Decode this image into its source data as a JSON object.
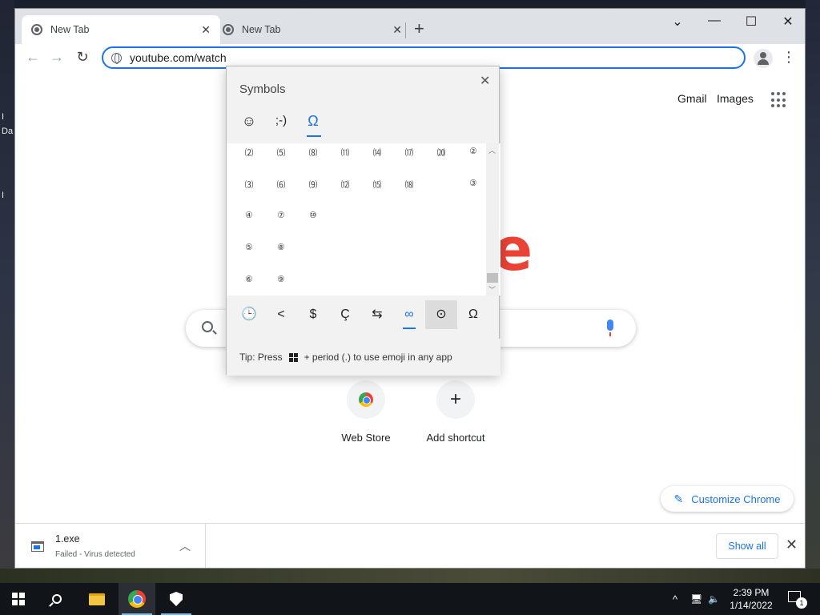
{
  "desktop": {
    "left_texts": [
      "I",
      "Da",
      "I"
    ]
  },
  "browser": {
    "tabs": [
      {
        "title": "New Tab",
        "active": true
      },
      {
        "title": "New Tab",
        "active": false
      }
    ],
    "new_tab_symbol": "+",
    "window_controls": {
      "tab_search": "⌄",
      "minimize": "—",
      "maximize": "☐",
      "close": "✕"
    },
    "nav": {
      "back": "←",
      "forward": "→",
      "reload": "↻"
    },
    "address": "youtube.com/watch",
    "menu": "⋮"
  },
  "ntp": {
    "links": [
      "Gmail",
      "Images"
    ],
    "logo_fragment": "e",
    "shortcuts": [
      {
        "label": "Web Store",
        "icon": "chrome-webstore-icon"
      },
      {
        "label": "Add shortcut",
        "icon": "plus-icon",
        "symbol": "+"
      }
    ],
    "customize_label": "Customize Chrome"
  },
  "downloads": {
    "file_name": "1.exe",
    "status": "Failed - Virus detected",
    "show_all": "Show all"
  },
  "emoji_panel": {
    "title": "Symbols",
    "close": "✕",
    "tabs": [
      {
        "symbol": "☺",
        "name": "emoji"
      },
      {
        "symbol": ";-)",
        "name": "kaomoji"
      },
      {
        "symbol": "Ω",
        "name": "symbols",
        "active": true
      }
    ],
    "grid_columns": [
      [
        "⑵",
        "⑶",
        "④",
        "⑤",
        "⑥"
      ],
      [
        "⑸",
        "⑹",
        "⑦",
        "⑧",
        "⑨"
      ],
      [
        "⑻",
        "⑼",
        "⑩"
      ],
      [
        "⑾",
        "⑿"
      ],
      [
        "⒁",
        "⒂"
      ],
      [
        "⒄",
        "⒅"
      ],
      [
        "⒇"
      ],
      [
        "②",
        "③"
      ]
    ],
    "categories": [
      "🕒",
      "<",
      "$",
      "Ç",
      "⇆",
      "∞",
      "⊙",
      "Ω"
    ],
    "active_category": "∞",
    "hover_category": "⊙",
    "tip_prefix": "Tip: Press",
    "tip_suffix": "+ period (.) to use emoji in any app"
  },
  "taskbar": {
    "time": "2:39 PM",
    "date": "1/14/2022",
    "notification_count": "1",
    "tray_chevron": "^"
  }
}
